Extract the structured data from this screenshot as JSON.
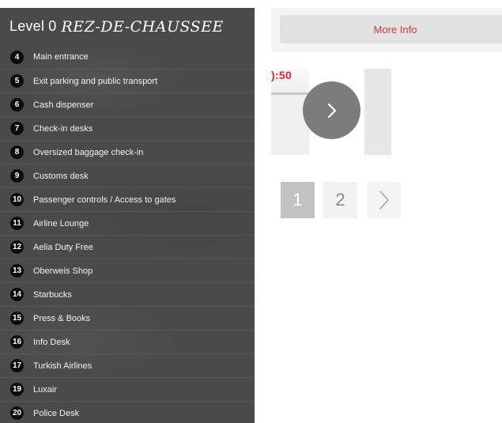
{
  "legend": {
    "level_prefix": "Level 0",
    "level_name": "REZ-DE-CHAUSSEE",
    "items": [
      {
        "number": "4",
        "label": "Main entrance"
      },
      {
        "number": "5",
        "label": "Exit parking and public transport"
      },
      {
        "number": "6",
        "label": "Cash dispenser"
      },
      {
        "number": "7",
        "label": "Check-in desks"
      },
      {
        "number": "8",
        "label": "Oversized baggage check-in"
      },
      {
        "number": "9",
        "label": "Customs desk"
      },
      {
        "number": "10",
        "label": "Passenger controls / Access to gates"
      },
      {
        "number": "11",
        "label": "Airline Lounge"
      },
      {
        "number": "12",
        "label": "Aelia Duty Free"
      },
      {
        "number": "13",
        "label": "Oberweis Shop"
      },
      {
        "number": "14",
        "label": "Starbucks"
      },
      {
        "number": "15",
        "label": "Press & Books"
      },
      {
        "number": "16",
        "label": "Info Desk"
      },
      {
        "number": "17",
        "label": "Turkish Airlines"
      },
      {
        "number": "19",
        "label": "Luxair"
      },
      {
        "number": "20",
        "label": "Police Desk"
      }
    ]
  },
  "more_info": {
    "label": "More Info",
    "color": "#d9363e"
  },
  "carousel": {
    "thumb_time_text": "):50",
    "next_icon": "chevron-right-icon"
  },
  "pagination": {
    "pages": [
      "1",
      "2"
    ],
    "current": "1",
    "next_icon": "chevron-right-icon"
  },
  "colors": {
    "panel_bg": "#4a4a4a",
    "badge_bg": "#0c0c0c",
    "accent_red": "#e5252f"
  }
}
